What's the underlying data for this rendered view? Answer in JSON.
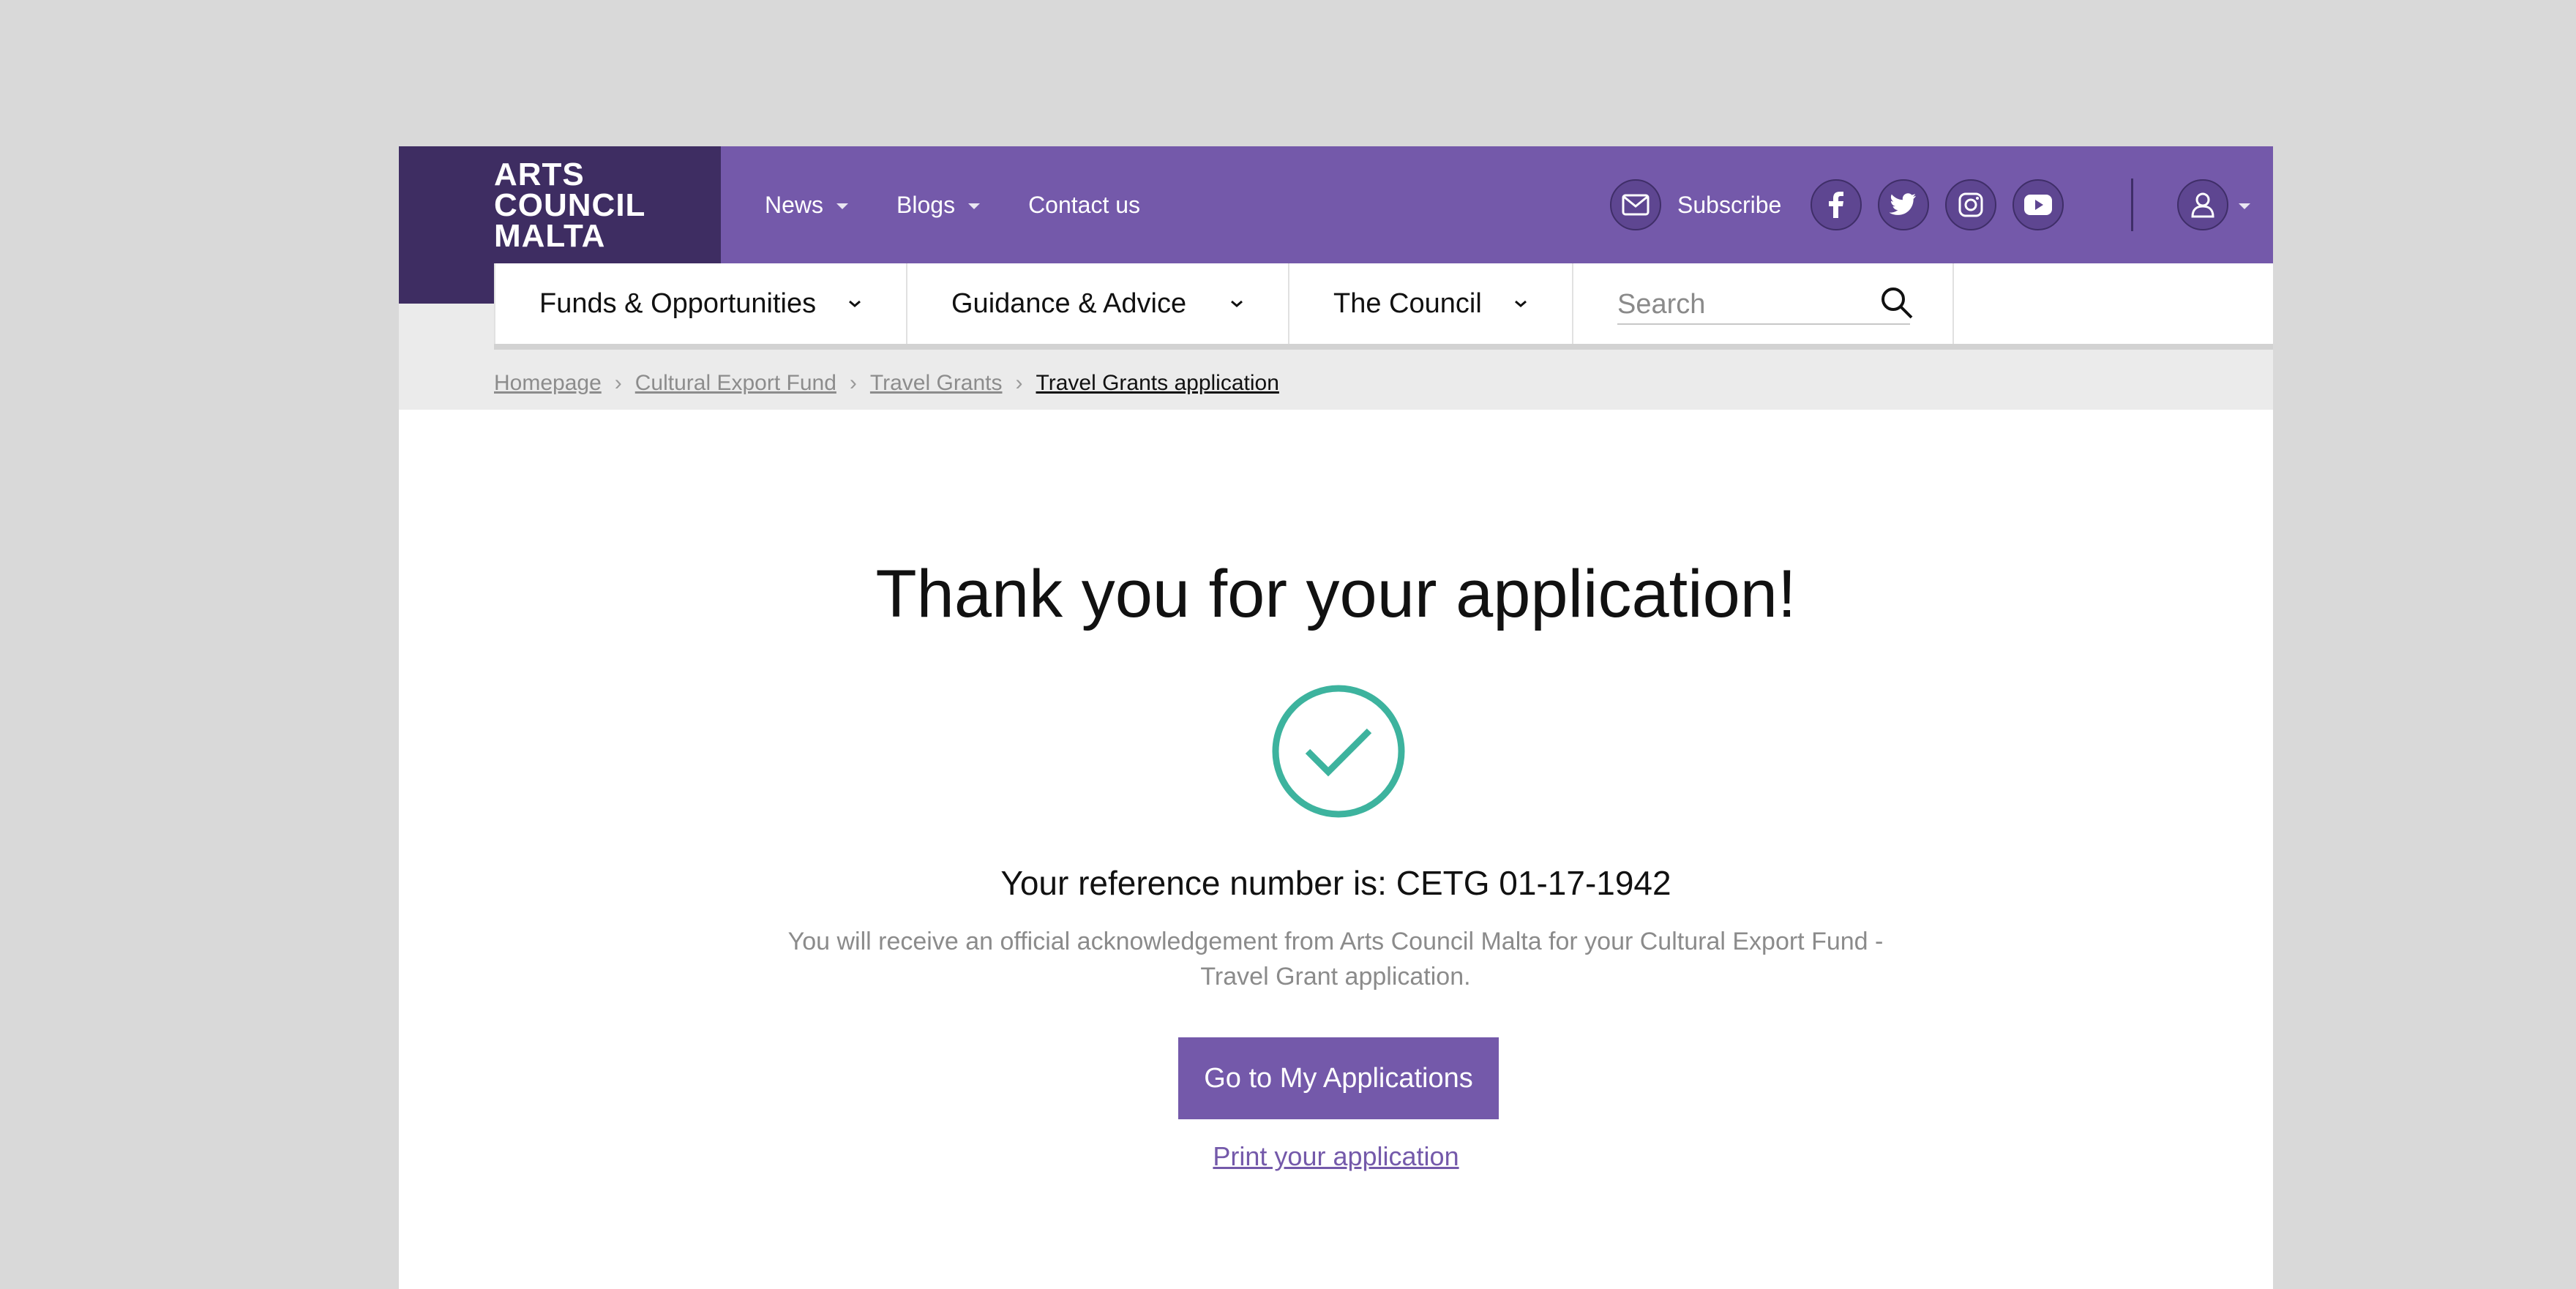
{
  "logo": {
    "text": "ARTS\nCOUNCIL\nMALTA"
  },
  "topnav": [
    {
      "label": "News",
      "has_menu": true
    },
    {
      "label": "Blogs",
      "has_menu": true
    },
    {
      "label": "Contact us",
      "has_menu": false
    }
  ],
  "subscribe": {
    "label": "Subscribe"
  },
  "social_icons": [
    "facebook-icon",
    "twitter-icon",
    "instagram-icon",
    "youtube-icon"
  ],
  "mainnav": [
    {
      "label": "Funds & Opportunities"
    },
    {
      "label": "Guidance & Advice"
    },
    {
      "label": "The Council"
    }
  ],
  "search": {
    "placeholder": "Search",
    "value": ""
  },
  "breadcrumb": [
    {
      "label": "Homepage"
    },
    {
      "label": "Cultural Export Fund"
    },
    {
      "label": "Travel Grants"
    },
    {
      "label": "Travel Grants application"
    }
  ],
  "content": {
    "title": "Thank you for your application!",
    "reference": "Your reference number is: CETG 01-17-1942",
    "message": "You will receive an official acknowledgement from Arts Council Malta for your Cultural Export Fund - Travel Grant application.",
    "cta_label": "Go to My Applications",
    "print_label": "Print your application"
  },
  "colors": {
    "brand_purple": "#7459aa",
    "logo_dark_purple": "#3e2d62",
    "success_green": "#3db39e"
  }
}
